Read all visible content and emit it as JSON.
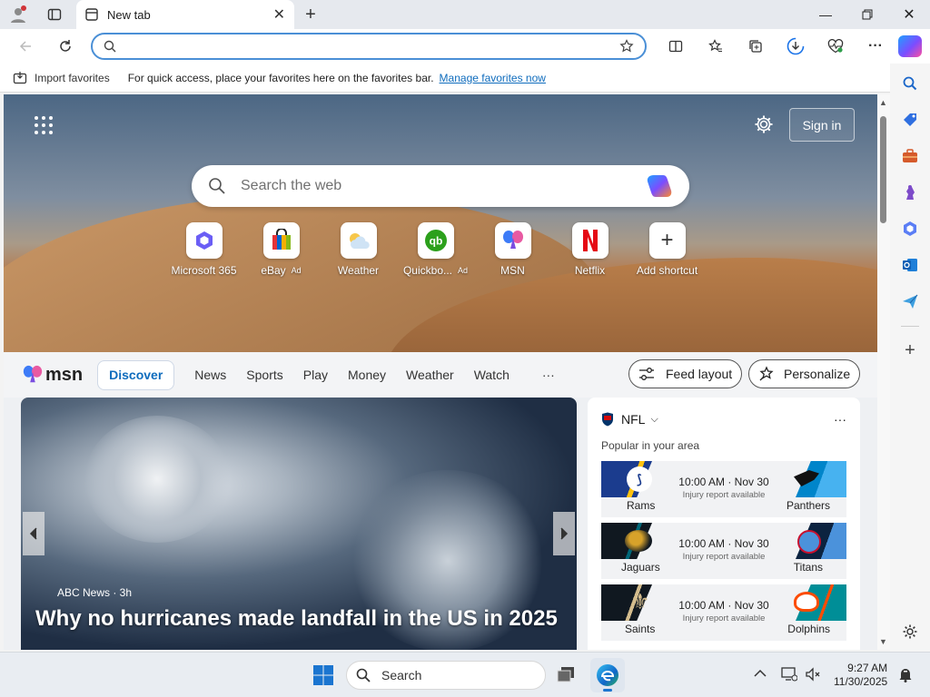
{
  "browser": {
    "tab_title": "New tab",
    "address_value": "",
    "favorites_bar": {
      "import_label": "Import favorites",
      "message": "For quick access, place your favorites here on the favorites bar.",
      "manage_link": "Manage favorites now"
    }
  },
  "ntp": {
    "sign_in": "Sign in",
    "search_placeholder": "Search the web",
    "shortcuts": [
      {
        "label": "Microsoft 365",
        "ad": "",
        "icon": "microsoft-365-icon"
      },
      {
        "label": "eBay",
        "ad": "Ad",
        "icon": "ebay-icon"
      },
      {
        "label": "Weather",
        "ad": "",
        "icon": "weather-icon"
      },
      {
        "label": "Quickbo...",
        "ad": "Ad",
        "icon": "quickbooks-icon"
      },
      {
        "label": "MSN",
        "ad": "",
        "icon": "msn-icon"
      },
      {
        "label": "Netflix",
        "ad": "",
        "icon": "netflix-icon"
      },
      {
        "label": "Add shortcut",
        "ad": "",
        "icon": "plus-icon"
      }
    ]
  },
  "feed": {
    "logo_text": "msn",
    "tabs": [
      "Discover",
      "News",
      "Sports",
      "Play",
      "Money",
      "Weather",
      "Watch"
    ],
    "more": "···",
    "feed_layout": "Feed layout",
    "personalize": "Personalize",
    "hero": {
      "source": "ABC News · 3h",
      "headline": "Why no hurricanes made landfall in the US in 2025"
    },
    "nfl": {
      "league": "NFL",
      "subtitle": "Popular in your area",
      "games": [
        {
          "home": "Rams",
          "away": "Panthers",
          "time": "10:00 AM · Nov 30",
          "note": "Injury report available",
          "home_color": "#1b3c8e",
          "away_color": "#1e8fd3"
        },
        {
          "home": "Jaguars",
          "away": "Titans",
          "time": "10:00 AM · Nov 30",
          "note": "Injury report available",
          "home_color": "#1f1f1f",
          "away_color": "#14345e"
        },
        {
          "home": "Saints",
          "away": "Dolphins",
          "time": "10:00 AM · Nov 30",
          "note": "Injury report available",
          "home_color": "#1f1f1f",
          "away_color": "#138a98"
        }
      ]
    }
  },
  "taskbar": {
    "search": "Search",
    "time": "9:27 AM",
    "date": "11/30/2025"
  }
}
